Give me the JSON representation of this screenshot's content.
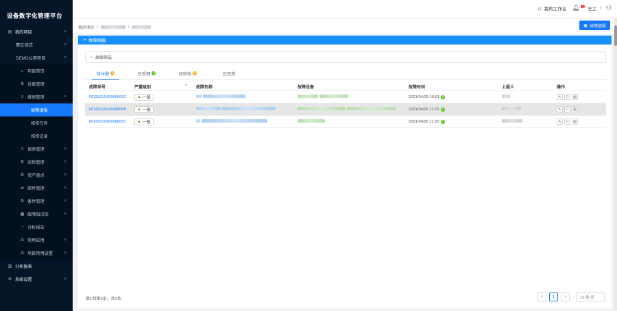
{
  "app": {
    "title": "设备数字化管理平台"
  },
  "sidebar": {
    "items": [
      {
        "label": "我的项目",
        "level": 0,
        "icon": "folder-icon",
        "expand": "up"
      },
      {
        "label": "赛云测试",
        "level": 1,
        "expand": "down"
      },
      {
        "label": "DEMO公用项目",
        "level": 1,
        "expand": "up"
      },
      {
        "label": "项目首页",
        "level": 2,
        "icon": "home-icon"
      },
      {
        "label": "设备管理",
        "level": 2,
        "icon": "gear-icon"
      },
      {
        "label": "维修管理",
        "level": 2,
        "icon": "list-icon",
        "expand": "up"
      },
      {
        "label": "故障填报",
        "level": 3,
        "active": true
      },
      {
        "label": "维修任务",
        "level": 3
      },
      {
        "label": "维修记录",
        "level": 3
      },
      {
        "label": "保养管理",
        "level": 2,
        "icon": "list-icon",
        "expand": "down"
      },
      {
        "label": "巡检管理",
        "level": 2,
        "icon": "gear-icon",
        "expand": "down"
      },
      {
        "label": "资产盘点",
        "level": 2,
        "icon": "gear-icon",
        "expand": "down"
      },
      {
        "label": "部件管理",
        "level": 2,
        "icon": "link-icon",
        "expand": "down"
      },
      {
        "label": "备件管理",
        "level": 2,
        "icon": "gear-icon",
        "expand": "down"
      },
      {
        "label": "故障知识库",
        "level": 2,
        "icon": "book-icon",
        "expand": "down"
      },
      {
        "label": "分析报告",
        "level": 2,
        "icon": "chart-icon"
      },
      {
        "label": "常用应用",
        "level": 2,
        "icon": "apps-icon",
        "expand": "down"
      },
      {
        "label": "项目常用设置",
        "level": 2,
        "icon": "apps-icon",
        "expand": "down"
      },
      {
        "label": "分析报表",
        "level": 0,
        "icon": "report-icon"
      },
      {
        "label": "系统设置",
        "level": 0,
        "icon": "gear-icon",
        "expand": "down"
      }
    ]
  },
  "header": {
    "workbench": "我的工作台",
    "notify_count": "6",
    "user": "王工"
  },
  "breadcrumb": {
    "root": "我的项目",
    "sep": "/"
  },
  "toolbar": {
    "report_button": "故障填报"
  },
  "panel": {
    "title": "故障填报"
  },
  "filter": {
    "label": "高级筛选"
  },
  "tabs": [
    {
      "label": "待分配",
      "count": "3",
      "color": "#faad14"
    },
    {
      "label": "已受理",
      "count": "0",
      "color": "#52c41a"
    },
    {
      "label": "待验收",
      "count": "0",
      "color": "#faad14"
    },
    {
      "label": "已完成",
      "count": ""
    }
  ],
  "table": {
    "columns": [
      "故障单号",
      "严重级别",
      "故障名称",
      "故障设备",
      "故障时间",
      "上报人",
      "操作"
    ],
    "rows": [
      {
        "id": "RO20210429000002",
        "severity": "一般",
        "time": "2021/04/29 16:51",
        "days": "2"
      },
      {
        "id": "RO20210426000005",
        "severity": "一般",
        "time": "2021/04/26 11:21",
        "days": "5"
      },
      {
        "id": "RO20210426000001",
        "severity": "一般",
        "time": "2021/04/26 11:20",
        "days": "5"
      }
    ]
  },
  "pagination": {
    "summary": "第1到第3条，共3条",
    "prev": "<",
    "current": "1",
    "next": ">",
    "page_size": "10 条/页"
  }
}
